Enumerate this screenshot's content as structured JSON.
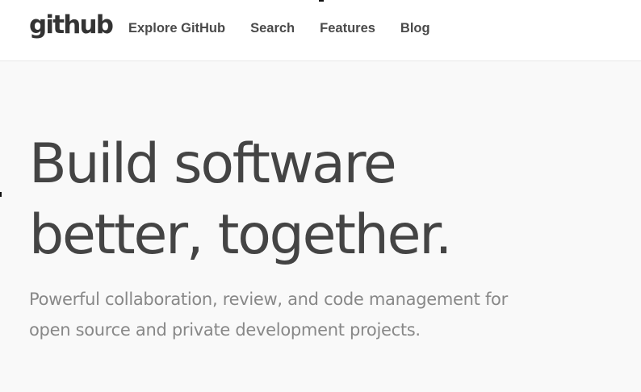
{
  "header": {
    "logo_text": "github",
    "nav": [
      {
        "label": "Explore GitHub"
      },
      {
        "label": "Search"
      },
      {
        "label": "Features"
      },
      {
        "label": "Blog"
      }
    ]
  },
  "hero": {
    "headline_line1": "Build software",
    "headline_line2": "better, together.",
    "subtitle_line1": "Powerful collaboration, review, and code management for",
    "subtitle_line2": "open source and private development projects."
  }
}
